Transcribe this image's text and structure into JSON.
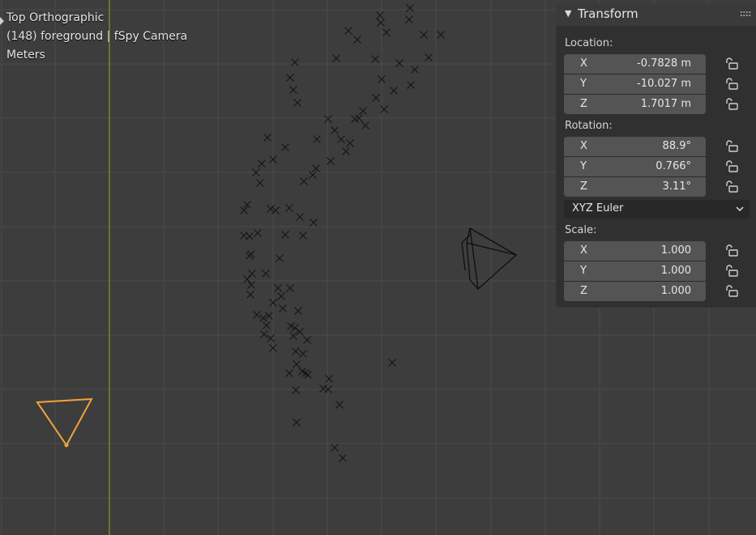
{
  "viewport": {
    "view_name": "Top Orthographic",
    "object_info": "(148) foreground | fSpy Camera",
    "units": "Meters"
  },
  "panel": {
    "title": "Transform",
    "location": {
      "label": "Location:",
      "x": {
        "axis": "X",
        "value": "-0.7828 m"
      },
      "y": {
        "axis": "Y",
        "value": "-10.027 m"
      },
      "z": {
        "axis": "Z",
        "value": "1.7017 m"
      }
    },
    "rotation": {
      "label": "Rotation:",
      "x": {
        "axis": "X",
        "value": "88.9°"
      },
      "y": {
        "axis": "Y",
        "value": "0.766°"
      },
      "z": {
        "axis": "Z",
        "value": "3.11°"
      }
    },
    "rotation_mode": "XYZ Euler",
    "scale": {
      "label": "Scale:",
      "x": {
        "axis": "X",
        "value": "1.000"
      },
      "y": {
        "axis": "Y",
        "value": "1.000"
      },
      "z": {
        "axis": "Z",
        "value": "1.000"
      }
    }
  },
  "colors": {
    "background": "#3d3d3d",
    "grid": "#4a4a4a",
    "y_axis": "#6f8f2a",
    "marker": "#141414",
    "selected_camera": "#f2a33a"
  }
}
